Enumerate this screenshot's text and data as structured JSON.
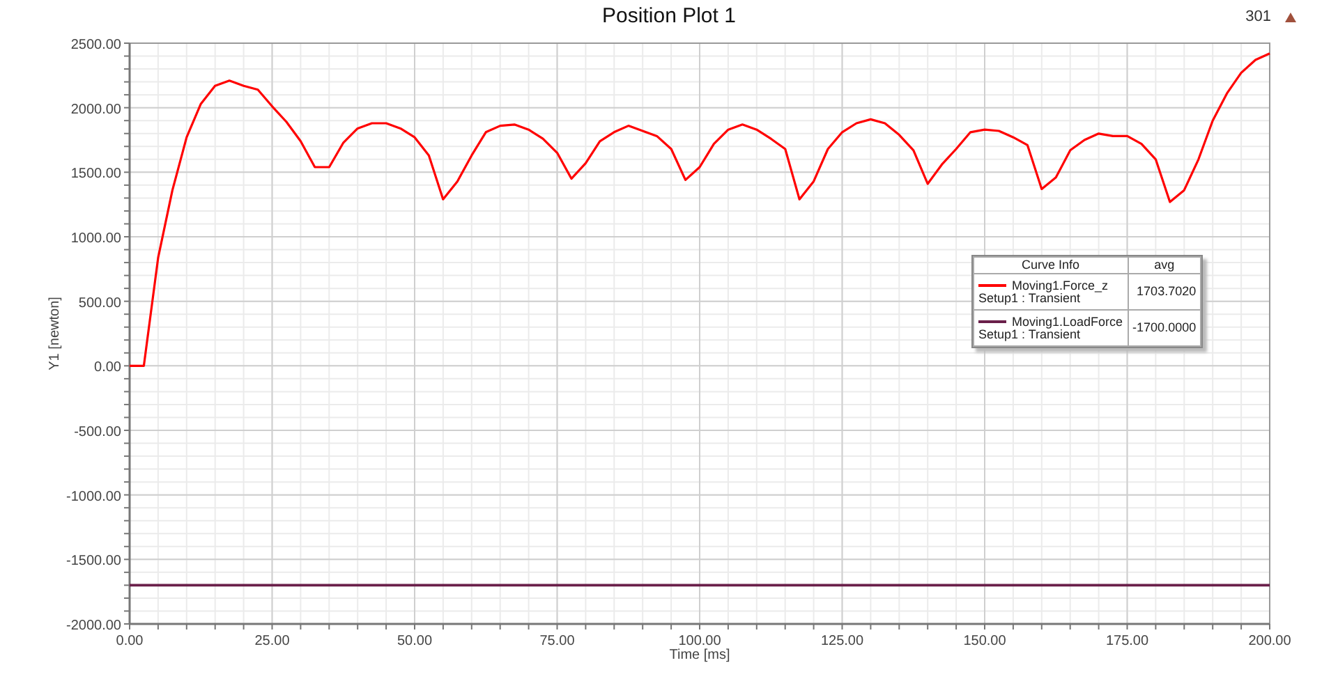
{
  "plot": {
    "title": "Position Plot 1",
    "counter": "301",
    "chart_data": {
      "type": "line",
      "grid": true,
      "legend": true,
      "xlabel": "Time [ms]",
      "ylabel": "Y1 [newton]",
      "xlim": [
        0,
        200
      ],
      "ylim": [
        -2000,
        2500
      ],
      "xticks": [
        {
          "value": 0,
          "label": "0.00"
        },
        {
          "value": 25,
          "label": "25.00"
        },
        {
          "value": 50,
          "label": "50.00"
        },
        {
          "value": 75,
          "label": "75.00"
        },
        {
          "value": 100,
          "label": "100.00"
        },
        {
          "value": 125,
          "label": "125.00"
        },
        {
          "value": 150,
          "label": "150.00"
        },
        {
          "value": 175,
          "label": "175.00"
        },
        {
          "value": 200,
          "label": "200.00"
        }
      ],
      "yticks": [
        {
          "value": 2500,
          "label": "2500.00"
        },
        {
          "value": 2000,
          "label": "2000.00"
        },
        {
          "value": 1500,
          "label": "1500.00"
        },
        {
          "value": 1000,
          "label": "1000.00"
        },
        {
          "value": 500,
          "label": "500.00"
        },
        {
          "value": 0,
          "label": "0.00"
        },
        {
          "value": -500,
          "label": "-500.00"
        },
        {
          "value": -1000,
          "label": "-1000.00"
        },
        {
          "value": -1500,
          "label": "-1500.00"
        },
        {
          "value": -2000,
          "label": "-2000.00"
        }
      ],
      "x": [
        0,
        2.5,
        5,
        7.5,
        10,
        12.5,
        15,
        17.5,
        20,
        22.5,
        25,
        27.5,
        30,
        32.5,
        35,
        37.5,
        40,
        42.5,
        45,
        47.5,
        50,
        52.5,
        55,
        57.5,
        60,
        62.5,
        65,
        67.5,
        70,
        72.5,
        75,
        77.5,
        80,
        82.5,
        85,
        87.5,
        90,
        92.5,
        95,
        97.5,
        100,
        102.5,
        105,
        107.5,
        110,
        112.5,
        115,
        117.5,
        120,
        122.5,
        125,
        127.5,
        130,
        132.5,
        135,
        137.5,
        140,
        142.5,
        145,
        147.5,
        150,
        152.5,
        155,
        157.5,
        160,
        162.5,
        165,
        167.5,
        170,
        172.5,
        175,
        177.5,
        180,
        182.5,
        185,
        187.5,
        190,
        192.5,
        195,
        197.5,
        200
      ],
      "series": [
        {
          "name": "Moving1.Force_z",
          "color": "#ff0000",
          "values": [
            0,
            0,
            840,
            1360,
            1770,
            2030,
            2170,
            2210,
            2170,
            2140,
            2010,
            1890,
            1740,
            1540,
            1540,
            1730,
            1840,
            1880,
            1880,
            1840,
            1770,
            1630,
            1290,
            1430,
            1630,
            1810,
            1860,
            1870,
            1830,
            1760,
            1650,
            1450,
            1570,
            1740,
            1810,
            1860,
            1820,
            1780,
            1680,
            1440,
            1540,
            1720,
            1830,
            1870,
            1830,
            1760,
            1680,
            1290,
            1430,
            1680,
            1810,
            1880,
            1910,
            1880,
            1790,
            1670,
            1410,
            1560,
            1680,
            1810,
            1830,
            1820,
            1770,
            1710,
            1370,
            1460,
            1670,
            1750,
            1800,
            1780,
            1780,
            1720,
            1600,
            1270,
            1360,
            1600,
            1900,
            2110,
            2270,
            2370,
            2420
          ]
        },
        {
          "name": "Moving1.LoadForce",
          "color": "#6a1f4a",
          "values": [
            -1700,
            -1700,
            -1700,
            -1700,
            -1700,
            -1700,
            -1700,
            -1700,
            -1700,
            -1700,
            -1700,
            -1700,
            -1700,
            -1700,
            -1700,
            -1700,
            -1700,
            -1700,
            -1700,
            -1700,
            -1700,
            -1700,
            -1700,
            -1700,
            -1700,
            -1700,
            -1700,
            -1700,
            -1700,
            -1700,
            -1700,
            -1700,
            -1700,
            -1700,
            -1700,
            -1700,
            -1700,
            -1700,
            -1700,
            -1700,
            -1700,
            -1700,
            -1700,
            -1700,
            -1700,
            -1700,
            -1700,
            -1700,
            -1700,
            -1700,
            -1700,
            -1700,
            -1700,
            -1700,
            -1700,
            -1700,
            -1700,
            -1700,
            -1700,
            -1700,
            -1700,
            -1700,
            -1700,
            -1700,
            -1700,
            -1700,
            -1700,
            -1700,
            -1700,
            -1700,
            -1700,
            -1700,
            -1700,
            -1700,
            -1700,
            -1700,
            -1700,
            -1700,
            -1700,
            -1700,
            -1700
          ]
        }
      ]
    },
    "legend": {
      "columns": [
        "Curve Info",
        "avg"
      ],
      "rows": [
        {
          "setup": "Setup1 : Transient",
          "avg": "1703.7020"
        },
        {
          "setup": "Setup1 : Transient",
          "avg": "-1700.0000"
        }
      ]
    }
  }
}
